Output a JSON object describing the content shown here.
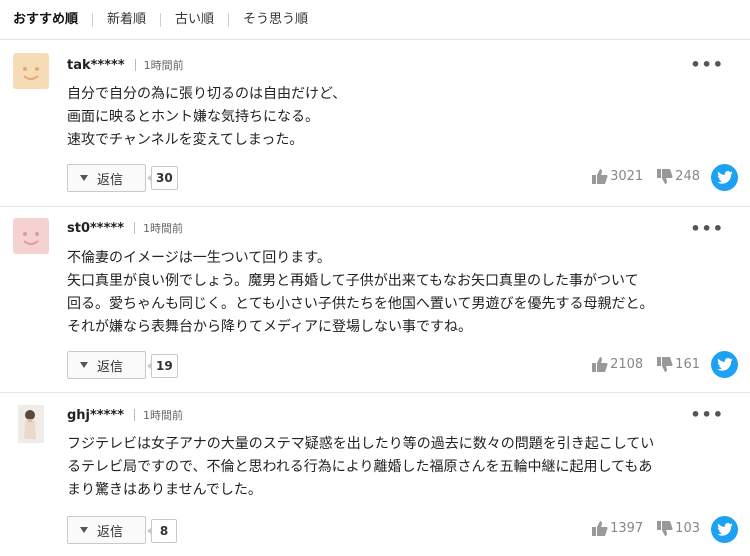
{
  "tabs": [
    "おすすめ順",
    "新着順",
    "古い順",
    "そう思う順"
  ],
  "comments": [
    {
      "user": "tak*****",
      "time": "1時間前",
      "text": "自分で自分の為に張り切るのは自由だけど、\n画面に映るとホント嫌な気持ちになる。\n速攻でチャンネルを変えてしまった。",
      "reply_label": "返信",
      "reply_count": "30",
      "likes": "3021",
      "dislikes": "248",
      "avatar": "smiley-yellow"
    },
    {
      "user": "st0*****",
      "time": "1時間前",
      "text": "不倫妻のイメージは一生ついて回ります。\n矢口真里が良い例でしょう。魔男と再婚して子供が出来てもなお矢口真里のした事がついて\n回る。愛ちゃんも同じく。とても小さい子供たちを他国へ置いて男遊びを優先する母親だと。\nそれが嫌なら表舞台から降りてメディアに登場しない事ですね。",
      "reply_label": "返信",
      "reply_count": "19",
      "likes": "2108",
      "dislikes": "161",
      "avatar": "smiley-pink"
    },
    {
      "user": "ghj*****",
      "time": "1時間前",
      "text": "フジテレビは女子アナの大量のステマ疑惑を出したり等の過去に数々の問題を引き起こしてい\nるテレビ局ですので、不倫と思われる行為により離婚した福原さんを五輪中継に起用してもあ\nまり驚きはありませんでした。",
      "reply_label": "返信",
      "reply_count": "8",
      "likes": "1397",
      "dislikes": "103",
      "avatar": "photo"
    }
  ],
  "more_label": "•••",
  "colors": {
    "twitter": "#1da1f2",
    "avatar_yellow": "#f6dbb7",
    "avatar_pink": "#f5d2d2"
  }
}
